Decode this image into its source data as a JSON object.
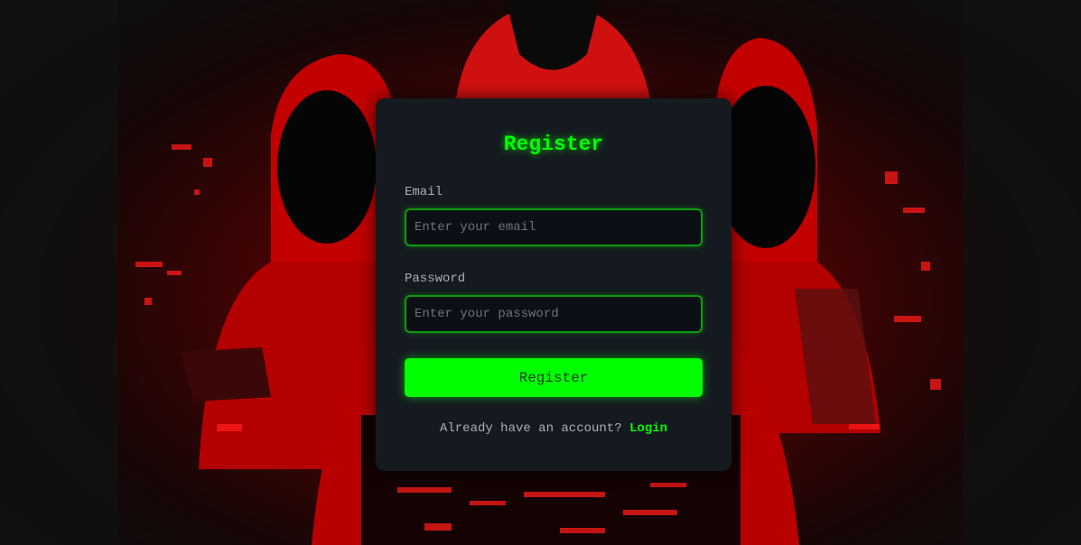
{
  "colors": {
    "accent": "#00ff00",
    "card_background": "#151a20",
    "background_red": "#8c0000"
  },
  "background": {
    "image": "hooded-hackers-illustration"
  },
  "form": {
    "title": "Register",
    "email_label": "Email",
    "email_placeholder": "Enter your email",
    "email_value": "",
    "password_label": "Password",
    "password_placeholder": "Enter your password",
    "password_value": "",
    "submit_label": "Register",
    "footer_text": "Already have an account?",
    "login_link": "Login"
  }
}
